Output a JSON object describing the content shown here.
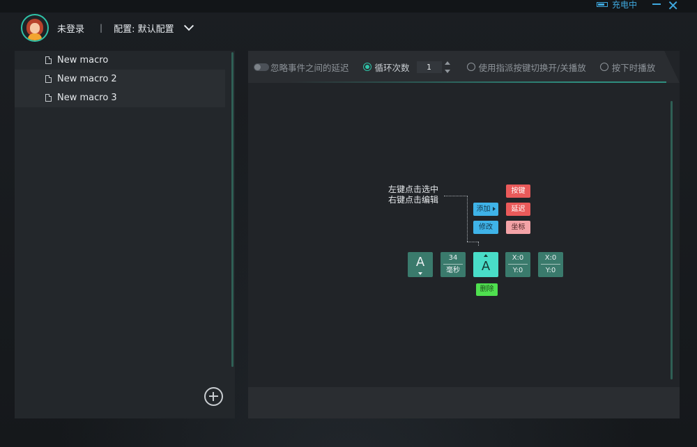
{
  "window": {
    "status_text": "充电中",
    "battery_label": "BAT"
  },
  "header": {
    "user": "未登录",
    "separator": "|",
    "config_label": "配置: 默认配置"
  },
  "macros": [
    {
      "label": "New macro"
    },
    {
      "label": "New macro 2"
    },
    {
      "label": "New macro 3"
    }
  ],
  "toolbar": {
    "ignore_delay_label": "忽略事件之间的延迟",
    "loop_label": "循环次数",
    "loop_count": "1",
    "toggle_label": "使用指派按键切换开/关播放",
    "hold_label": "按下时播放"
  },
  "diagram": {
    "hint_line1": "左键点击选中",
    "hint_line2": "右键点击编辑",
    "add_label": "添加",
    "edit_label": "修改",
    "key_label": "按键",
    "delay_label": "延迟",
    "coord_label": "坐标",
    "delete_label": "删除",
    "node1_key": "A",
    "delay_value": "34",
    "delay_unit": "毫秒",
    "node3_key": "A",
    "coord1_x": "X:0",
    "coord1_y": "Y:0",
    "coord2_x": "X:0",
    "coord2_y": "Y:0"
  },
  "colors": {
    "accent": "#2fc3a8",
    "status_blue": "#3fa9e0"
  }
}
